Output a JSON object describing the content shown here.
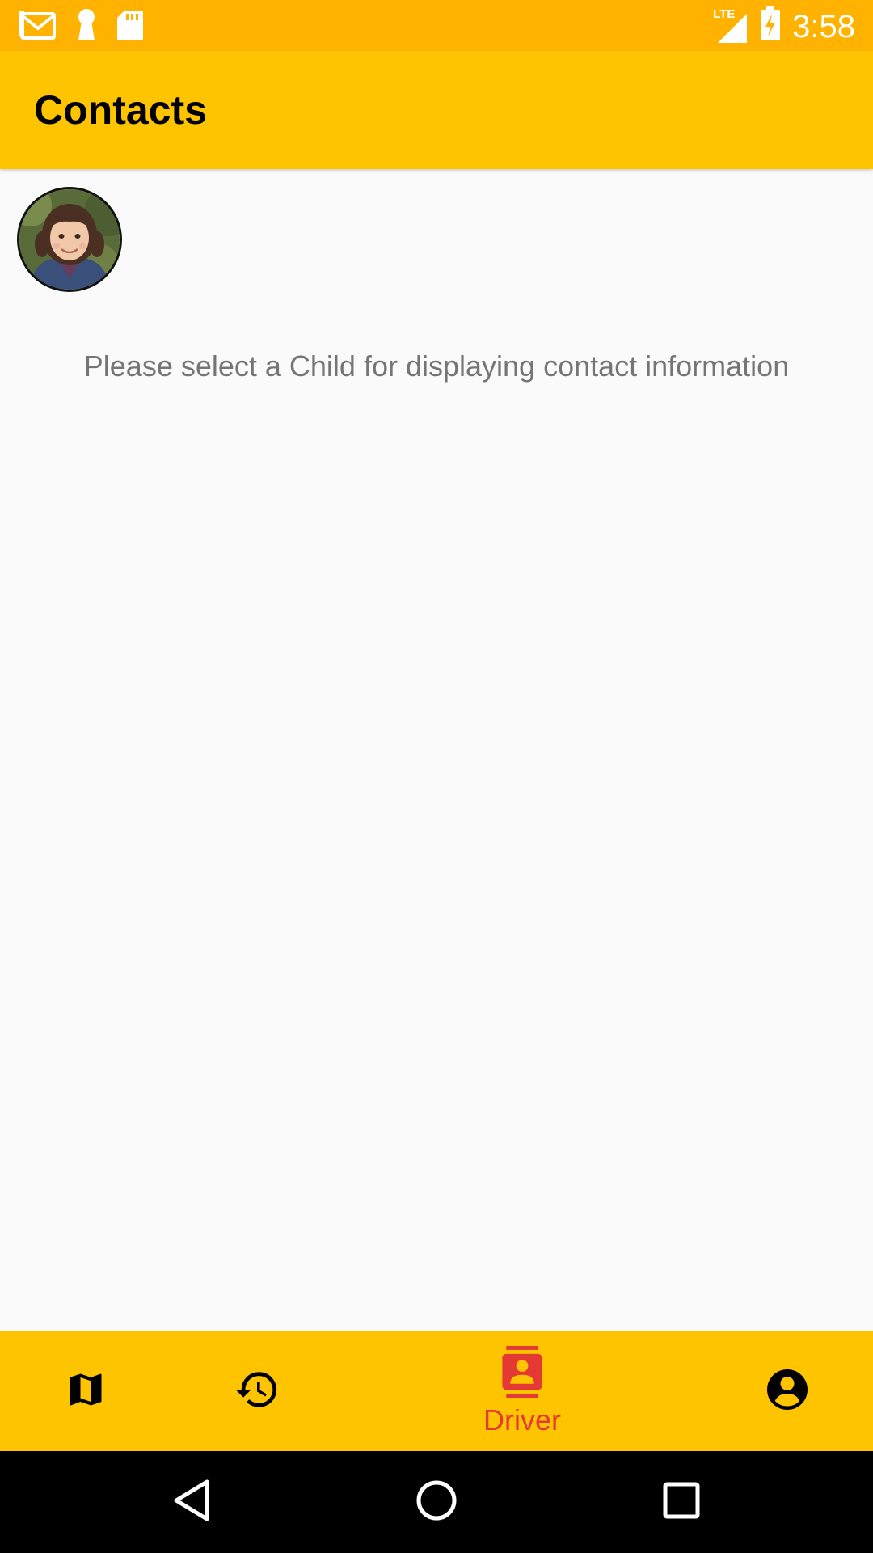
{
  "status_bar": {
    "time": "3:58",
    "network": "LTE",
    "icons": [
      "gmail-icon",
      "keyhole-icon",
      "sd-card-icon",
      "signal-icon",
      "battery-charging-icon"
    ]
  },
  "app_bar": {
    "title": "Contacts"
  },
  "children": [
    {
      "avatar": "child-photo"
    }
  ],
  "content": {
    "message": "Please select a Child for displaying contact information"
  },
  "bottom_nav": {
    "items": [
      {
        "icon": "map-icon",
        "label": "",
        "active": false
      },
      {
        "icon": "history-icon",
        "label": "",
        "active": false
      },
      {
        "icon": "contact-card-icon",
        "label": "Driver",
        "active": true
      },
      {
        "icon": "account-circle-icon",
        "label": "",
        "active": false
      }
    ]
  },
  "colors": {
    "status_bar": "#ffb300",
    "app_bar": "#ffc400",
    "active": "#e53935",
    "background": "#fafafa",
    "message_text": "#757575"
  }
}
